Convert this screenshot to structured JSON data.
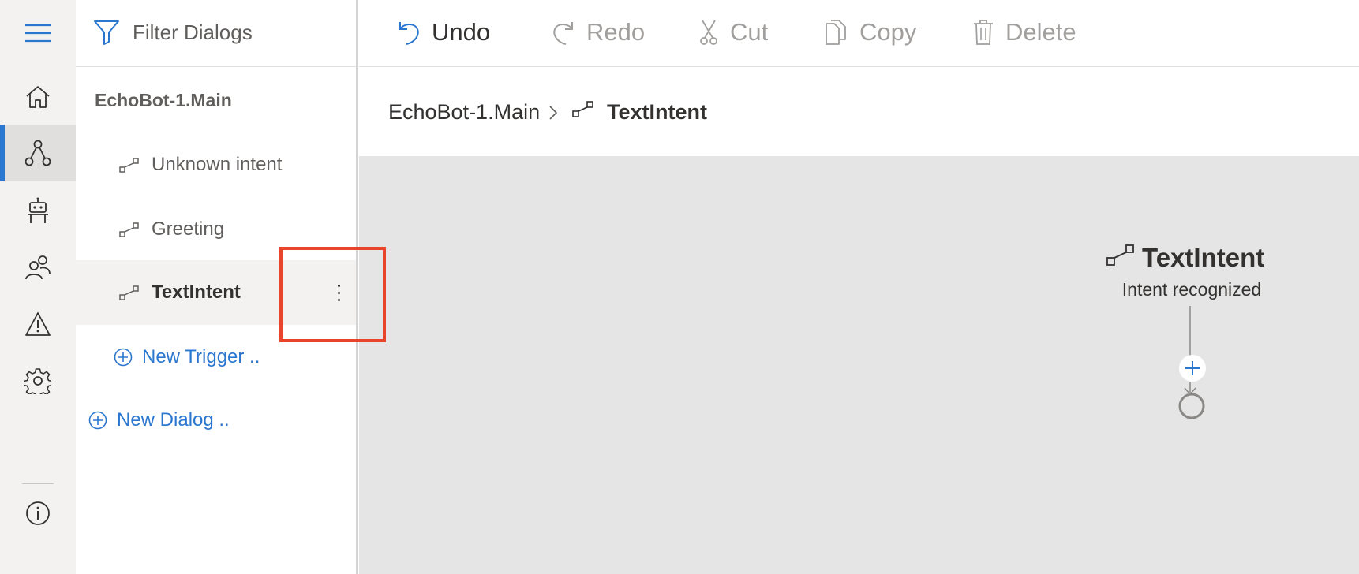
{
  "rail": {
    "items": [
      {
        "icon": "menu-icon"
      },
      {
        "icon": "home-icon"
      },
      {
        "icon": "dialogs-icon",
        "active": true
      },
      {
        "icon": "bot-icon"
      },
      {
        "icon": "users-icon"
      },
      {
        "icon": "warning-icon"
      },
      {
        "icon": "gear-icon"
      },
      {
        "icon": "info-icon"
      }
    ]
  },
  "panel": {
    "filter_label": "Filter Dialogs",
    "dialog_name": "EchoBot-1.Main",
    "triggers": [
      {
        "label": "Unknown intent",
        "selected": false
      },
      {
        "label": "Greeting",
        "selected": false
      },
      {
        "label": "TextIntent",
        "selected": true
      }
    ],
    "new_trigger_label": "New Trigger ..",
    "new_dialog_label": "New Dialog .."
  },
  "toolbar": {
    "undo_label": "Undo",
    "redo_label": "Redo",
    "cut_label": "Cut",
    "copy_label": "Copy",
    "delete_label": "Delete"
  },
  "breadcrumb": {
    "root": "EchoBot-1.Main",
    "current": "TextIntent"
  },
  "canvas": {
    "node_title": "TextIntent",
    "node_subtitle": "Intent recognized"
  },
  "colors": {
    "accent": "#2b77d0",
    "highlight": "#e8452c",
    "canvas_bg": "#e5e5e5",
    "rail_bg": "#f3f2f1"
  }
}
